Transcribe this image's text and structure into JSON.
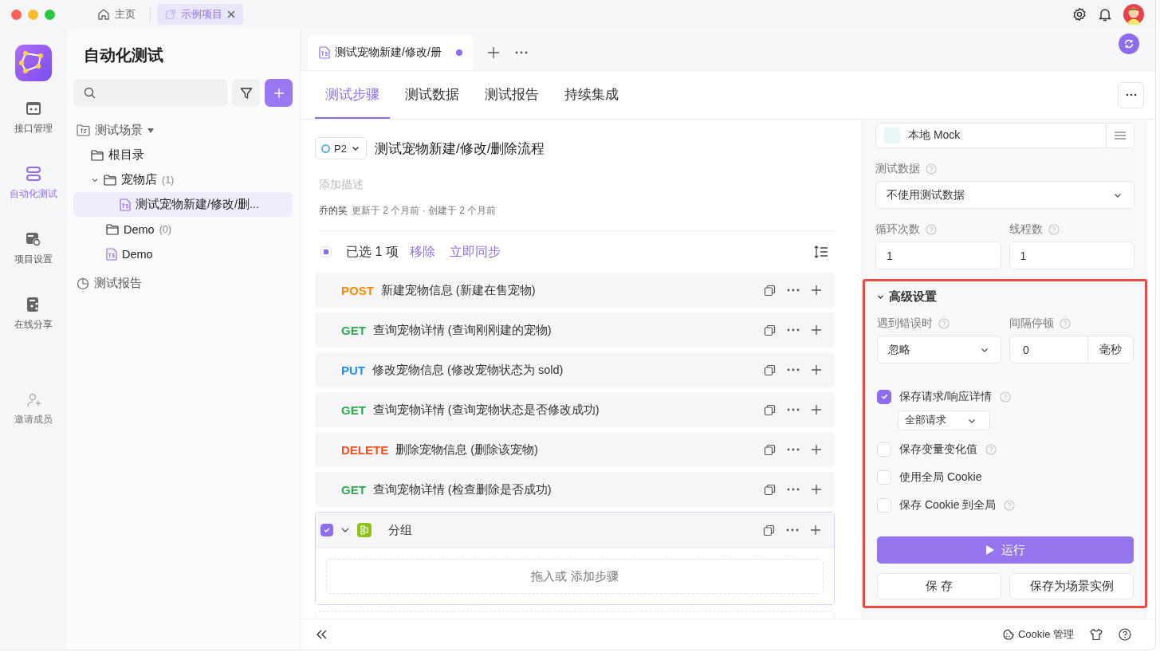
{
  "top_tabs": [
    {
      "kind": "home",
      "label": "主页",
      "selected": false
    },
    {
      "kind": "project",
      "label": "示例项目",
      "selected": true
    }
  ],
  "rail": [
    {
      "kind": "api",
      "label": "接口管理",
      "selected": false
    },
    {
      "kind": "auto",
      "label": "自动化测试",
      "selected": true
    },
    {
      "kind": "settings",
      "label": "项目设置",
      "selected": false
    },
    {
      "kind": "share",
      "label": "在线分享",
      "selected": false
    },
    {
      "kind": "invite",
      "label": "邀请成员",
      "selected": false
    }
  ],
  "tree": {
    "title": "自动化测试",
    "items": [
      {
        "kind": "section",
        "label": "测试场景",
        "selected": false,
        "expanded": true,
        "children": [
          {
            "kind": "folder",
            "label": "根目录",
            "selected": false
          },
          {
            "kind": "folder",
            "label": "宠物店",
            "count": "(1)",
            "selected": false,
            "expanded": true,
            "children": [
              {
                "kind": "scenario",
                "label": "测试宠物新建/修改/删...",
                "selected": true
              }
            ]
          },
          {
            "kind": "folder",
            "label": "Demo",
            "count": "(0)",
            "selected": false
          },
          {
            "kind": "scenario",
            "label": "Demo",
            "selected": false
          }
        ]
      },
      {
        "kind": "report",
        "label": "测试报告",
        "selected": false
      }
    ]
  },
  "editor_tab": {
    "label": "测试宠物新建/修改/册",
    "unsaved": true
  },
  "sub_tabs": [
    {
      "label": "测试步骤",
      "selected": true
    },
    {
      "label": "测试数据",
      "selected": false
    },
    {
      "label": "测试报告",
      "selected": false
    },
    {
      "label": "持续集成",
      "selected": false
    }
  ],
  "scenario": {
    "priority": "P2",
    "title": "测试宠物新建/修改/删除流程",
    "description_placeholder": "添加描述",
    "author": "乔的笑",
    "meta": "更新于 2 个月前 · 创建于 2 个月前"
  },
  "selection_bar": {
    "partial": true,
    "text": "已选 1 项",
    "actions": [
      "移除",
      "立即同步"
    ]
  },
  "steps": [
    {
      "kind": "request",
      "method": "POST",
      "name": "新建宠物信息 (新建在售宠物)"
    },
    {
      "kind": "request",
      "method": "GET",
      "name": "查询宠物详情 (查询刚刚建的宠物)"
    },
    {
      "kind": "request",
      "method": "PUT",
      "name": "修改宠物信息 (修改宠物状态为 sold)"
    },
    {
      "kind": "request",
      "method": "GET",
      "name": "查询宠物详情 (查询宠物状态是否修改成功)"
    },
    {
      "kind": "request",
      "method": "DELETE",
      "name": "删除宠物信息 (删除该宠物)"
    },
    {
      "kind": "request",
      "method": "GET",
      "name": "查询宠物详情 (检查删除是否成功)"
    },
    {
      "kind": "group",
      "name": "分组",
      "checked": true,
      "expanded": true,
      "placeholder": "拖入或 添加步骤"
    }
  ],
  "run_panel": {
    "environment": "本地 Mock",
    "test_data": {
      "label": "测试数据",
      "help": true,
      "value": "不使用测试数据"
    },
    "loops": {
      "label": "循环次数",
      "help": true,
      "value": "1"
    },
    "threads": {
      "label": "线程数",
      "help": true,
      "value": "1"
    },
    "advanced": {
      "title": "高级设置",
      "expanded": true,
      "highlighted": true,
      "on_error": {
        "label": "遇到错误时",
        "help": true,
        "value": "忽略"
      },
      "interval": {
        "label": "间隔停顿",
        "help": true,
        "value": "0",
        "unit": "毫秒"
      },
      "options": [
        {
          "label": "保存请求/响应详情",
          "checked": true,
          "help": true,
          "select": "全部请求"
        },
        {
          "label": "保存变量变化值",
          "checked": false,
          "help": true
        },
        {
          "label": "使用全局 Cookie",
          "checked": false,
          "help": false
        },
        {
          "label": "保存 Cookie 到全局",
          "checked": false,
          "help": true
        }
      ]
    },
    "run_button": "运行",
    "save_button": "保 存",
    "save_as_button": "保存为场景实例"
  },
  "status_bar": {
    "cookie": "Cookie 管理"
  }
}
